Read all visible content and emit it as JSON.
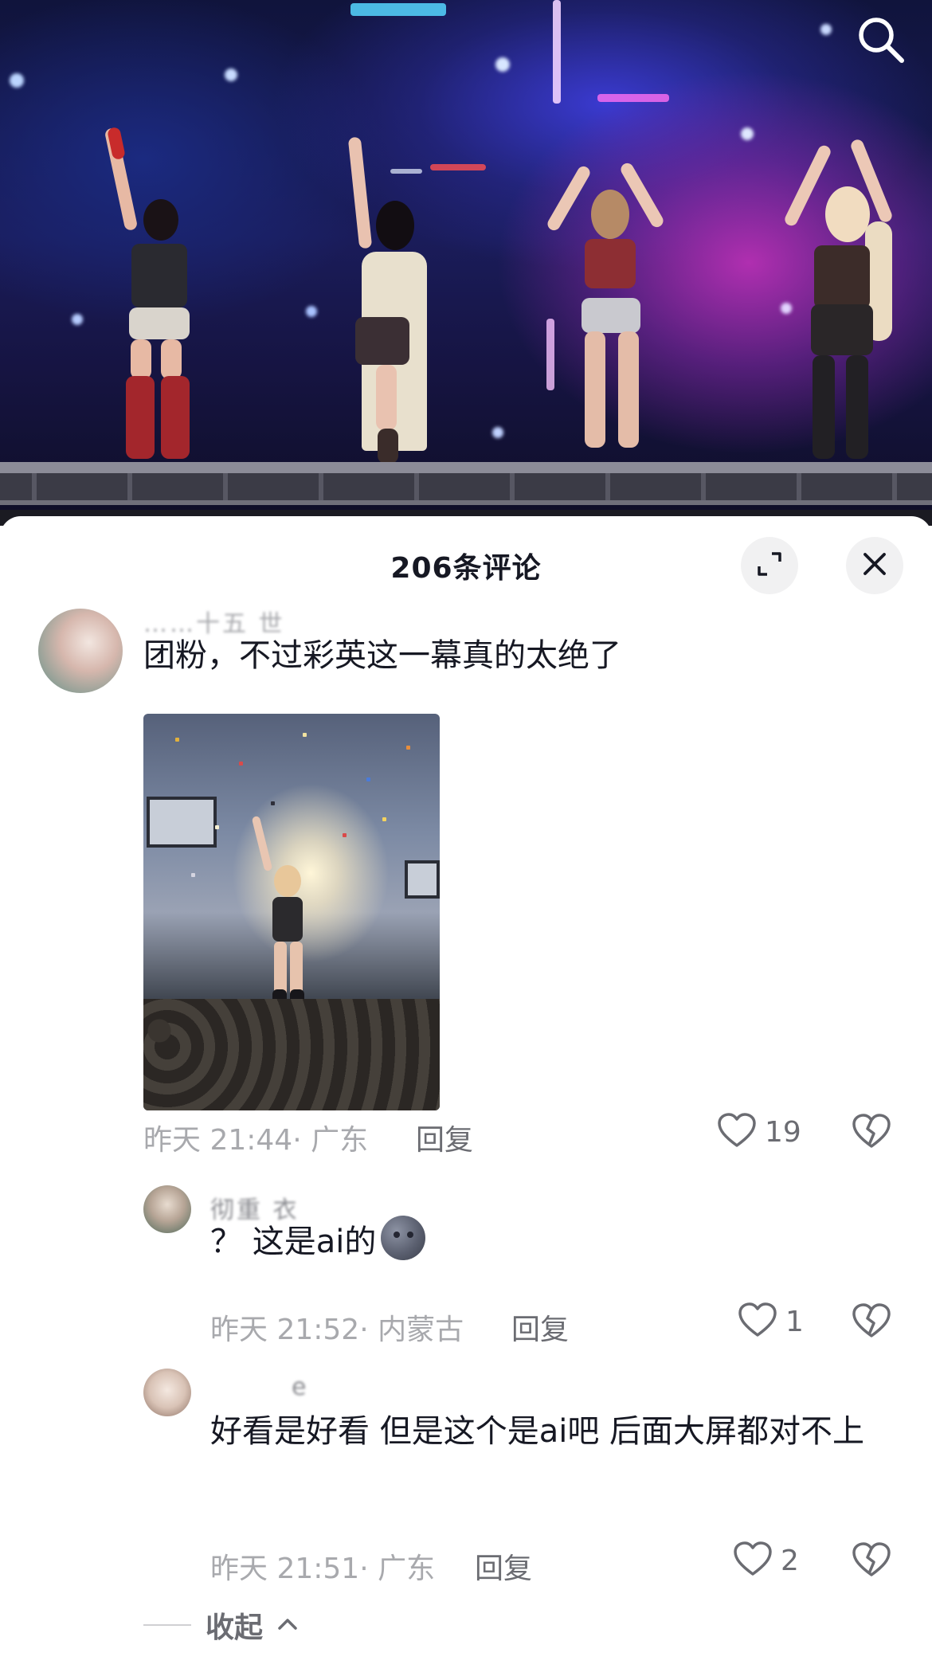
{
  "header": {
    "title": "206条评论",
    "expand_icon": "expand-icon",
    "close_icon": "close-icon",
    "search_icon": "search-icon"
  },
  "comments": [
    {
      "username": "……十五 世",
      "text": "团粉，不过彩英这一幕真的太绝了",
      "has_image": true,
      "time": "昨天 21:44",
      "location": "广东",
      "reply_label": "回复",
      "likes": "19"
    }
  ],
  "replies": [
    {
      "username": "彻重 衣",
      "text": "？ 这是ai的",
      "emoji": "new-moon-face-emoji",
      "time": "昨天 21:52",
      "location": "内蒙古",
      "reply_label": "回复",
      "likes": "1"
    },
    {
      "username": "e",
      "text": "好看是好看 但是这个是ai吧 后面大屏都对不上",
      "time": "昨天 21:51",
      "location": "广东",
      "reply_label": "回复",
      "likes": "2"
    }
  ],
  "collapse": {
    "label": "收起"
  },
  "colors": {
    "text": "#161823",
    "meta": "#a8a9ad",
    "muted": "#6b6c72"
  }
}
